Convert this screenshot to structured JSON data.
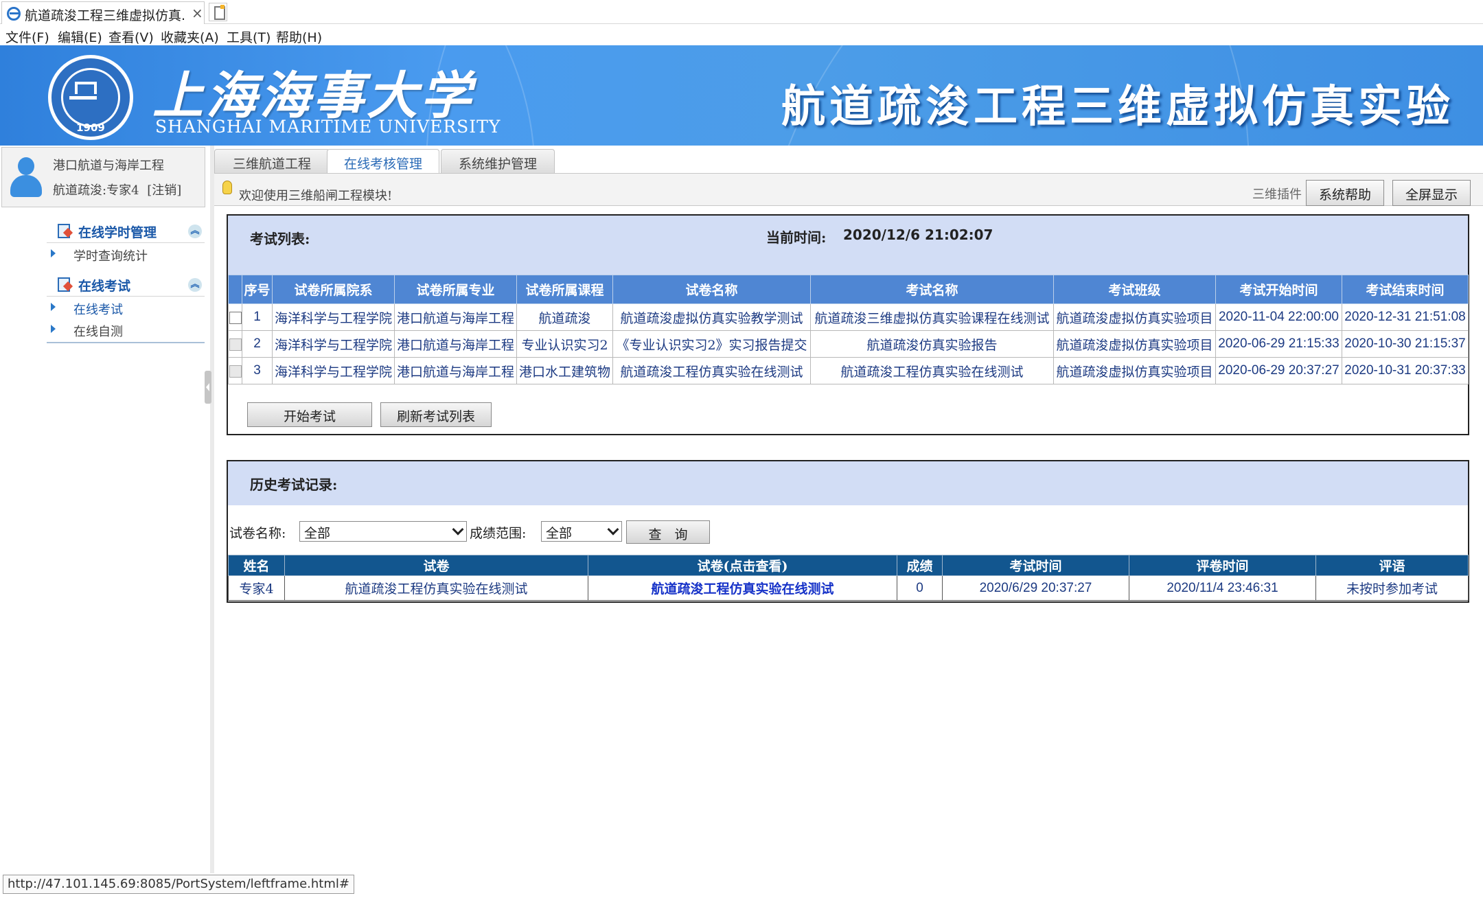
{
  "browser": {
    "tab_title": "航道疏浚工程三维虚拟仿真...",
    "tab_close": "×",
    "menu": [
      "文件(F)",
      "编辑(E)",
      "查看(V)",
      "收藏夹(A)",
      "工具(T)",
      "帮助(H)"
    ],
    "status_url": "http://47.101.145.69:8085/PortSystem/leftframe.html#"
  },
  "banner": {
    "university_cn": "上海海事大学",
    "university_en": "SHANGHAI MARITIME UNIVERSITY",
    "seal_year": "1909",
    "system_title": "航道疏浚工程三维虚拟仿真实验",
    "background_color": "#3e8fe3"
  },
  "user": {
    "department": "港口航道与海岸工程",
    "account": "航道疏浚:专家4",
    "logout": "[注销]"
  },
  "sidebar": {
    "groups": [
      {
        "label": "在线学时管理",
        "items": [
          {
            "label": "学时查询统计",
            "active": false
          }
        ]
      },
      {
        "label": "在线考试",
        "items": [
          {
            "label": "在线考试",
            "active": true
          },
          {
            "label": "在线自测",
            "active": false
          }
        ]
      }
    ],
    "collapse_icon": "︽"
  },
  "tabs": [
    {
      "label": "三维航道工程",
      "active": false
    },
    {
      "label": "在线考核管理",
      "active": true
    },
    {
      "label": "系统维护管理",
      "active": false
    }
  ],
  "toolbar": {
    "welcome": "欢迎使用三维船闸工程模块!",
    "plugin_label": "三维插件",
    "help_button": "系统帮助",
    "fullscreen_button": "全屏显示"
  },
  "exam_list": {
    "title": "考试列表:",
    "current_time_label": "当前时间:",
    "current_time": "2020/12/6 21:02:07",
    "columns": [
      "序号",
      "试卷所属院系",
      "试卷所属专业",
      "试卷所属课程",
      "试卷名称",
      "考试名称",
      "考试班级",
      "考试开始时间",
      "考试结束时间"
    ],
    "rows": [
      {
        "no": "1",
        "college": "海洋科学与工程学院",
        "major": "港口航道与海岸工程",
        "course": "航道疏浚",
        "paper": "航道疏浚虚拟仿真实验教学测试",
        "exam": "航道疏浚三维虚拟仿真实验课程在线测试",
        "class": "航道疏浚虚拟仿真实验项目",
        "start": "2020-11-04 22:00:00",
        "end": "2020-12-31 21:51:08",
        "enabled": true
      },
      {
        "no": "2",
        "college": "海洋科学与工程学院",
        "major": "港口航道与海岸工程",
        "course": "专业认识实习2",
        "paper": "《专业认识实习2》实习报告提交",
        "exam": "航道疏浚仿真实验报告",
        "class": "航道疏浚虚拟仿真实验项目",
        "start": "2020-06-29 21:15:33",
        "end": "2020-10-30 21:15:37",
        "enabled": false
      },
      {
        "no": "3",
        "college": "海洋科学与工程学院",
        "major": "港口航道与海岸工程",
        "course": "港口水工建筑物",
        "paper": "航道疏浚工程仿真实验在线测试",
        "exam": "航道疏浚工程仿真实验在线测试",
        "class": "航道疏浚虚拟仿真实验项目",
        "start": "2020-06-29 20:37:27",
        "end": "2020-10-31 20:37:33",
        "enabled": false
      }
    ],
    "start_button": "开始考试",
    "refresh_button": "刷新考试列表"
  },
  "history": {
    "title": "历史考试记录:",
    "paper_filter_label": "试卷名称:",
    "paper_filter_value": "全部",
    "score_filter_label": "成绩范围:",
    "score_filter_value": "全部",
    "query_button": "查　询",
    "columns": [
      "姓名",
      "试卷",
      "试卷(点击查看)",
      "成绩",
      "考试时间",
      "评卷时间",
      "评语"
    ],
    "rows": [
      {
        "name": "专家4",
        "paper": "航道疏浚工程仿真实验在线测试",
        "paper_link": "航道疏浚工程仿真实验在线测试",
        "score": "0",
        "exam_time": "2020/6/29 20:37:27",
        "grade_time": "2020/11/4 23:46:31",
        "comment": "未按时参加考试"
      }
    ]
  }
}
